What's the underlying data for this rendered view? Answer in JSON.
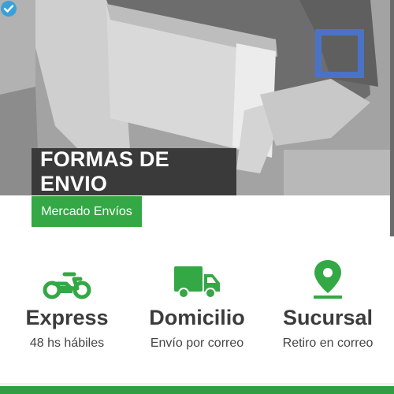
{
  "hero": {
    "title": "FORMAS DE ENVIO",
    "subtitle": "Mercado Envíos"
  },
  "options": [
    {
      "icon": "motorcycle-icon",
      "title": "Express",
      "subtitle": "48 hs hábiles"
    },
    {
      "icon": "truck-icon",
      "title": "Domicilio",
      "subtitle": "Envío por correo"
    },
    {
      "icon": "location-pin-icon",
      "title": "Sucursal",
      "subtitle": "Retiro en correo"
    }
  ],
  "colors": {
    "brand_green": "#33a845",
    "title_bg": "#3a3a3a",
    "badge_blue": "#4a73c7",
    "verified_blue": "#3aa0d8"
  }
}
